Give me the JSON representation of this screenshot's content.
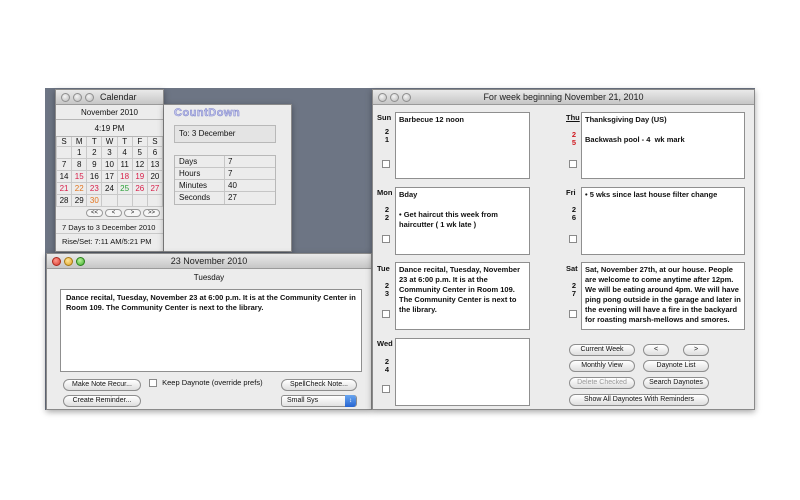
{
  "calendar": {
    "title": "Calendar",
    "month": "November 2010",
    "time": "4:19 PM",
    "weekdays": [
      "S",
      "M",
      "T",
      "W",
      "T",
      "F",
      "S"
    ],
    "weeks": [
      [
        "",
        "1",
        "2",
        "3",
        "4",
        "5",
        "6"
      ],
      [
        "7",
        "8",
        "9",
        "10",
        "11",
        "12",
        "13"
      ],
      [
        "14",
        "15",
        "16",
        "17",
        "18",
        "19",
        "20"
      ],
      [
        "21",
        "22",
        "23",
        "24",
        "25",
        "26",
        "27"
      ],
      [
        "28",
        "29",
        "30",
        "",
        "",
        "",
        ""
      ]
    ],
    "nav": [
      "<<",
      "<",
      ">",
      ">>"
    ],
    "days_to": "7 Days to 3 December 2010",
    "rise_set": "Rise/Set: 7:11 AM/5:21 PM"
  },
  "countdown": {
    "logo": "CountDown",
    "to": "To:  3 December",
    "rows": [
      {
        "k": "Days",
        "v": "7"
      },
      {
        "k": "Hours",
        "v": "7"
      },
      {
        "k": "Minutes",
        "v": "40"
      },
      {
        "k": "Seconds",
        "v": "27"
      }
    ]
  },
  "note": {
    "title": "23  November  2010",
    "day": "Tuesday",
    "text": "Dance recital, Tuesday, November 23 at 6:00 p.m.  It is at the  Community Center in Room 109.  The Community Center is next to the library.",
    "make_recurring": "Make Note Recur...",
    "keep_daynote": "Keep Daynote (override prefs)",
    "spellcheck": "SpellCheck Note...",
    "create_reminder": "Create Reminder...",
    "font_select": "Small Sys"
  },
  "week": {
    "title": "For week beginning November 21, 2010",
    "days": {
      "sun": {
        "label": "Sun",
        "n1": "2",
        "n2": "1",
        "text": "Barbecue 12 noon"
      },
      "mon": {
        "label": "Mon",
        "n1": "2",
        "n2": "2",
        "text": "Bday\n\n• Get haircut this week from  haircutter ( 1 wk late )"
      },
      "tue": {
        "label": "Tue",
        "n1": "2",
        "n2": "3",
        "text": "Dance recital, Tuesday, November 23 at 6:00 p.m.  It is at the  Community Center in Room 109.  The Community Center is next to the library."
      },
      "wed": {
        "label": "Wed",
        "n1": "2",
        "n2": "4",
        "text": ""
      },
      "thu": {
        "label": "Thu",
        "n1": "2",
        "n2": "5",
        "text": "Thanksgiving Day (US)\n\nBackwash pool - 4  wk mark"
      },
      "fri": {
        "label": "Fri",
        "n1": "2",
        "n2": "6",
        "text": "• 5 wks since last house filter change"
      },
      "sat": {
        "label": "Sat",
        "n1": "2",
        "n2": "7",
        "text": "Sat, November 27th, at our house.  People are welcome to come anytime after 12pm.  We will be eating around 4pm.  We will have ping pong outside in the garage and later in the evening will have a fire in the backyard for roasting marsh-mellows and smores."
      }
    },
    "buttons": {
      "current_week": "Current Week",
      "prev": "<",
      "next": ">",
      "monthly_view": "Monthly View",
      "daynote_list": "Daynote List",
      "delete_checked": "Delete Checked",
      "search_daynotes": "Search Daynotes",
      "show_all": "Show All Daynotes With Reminders"
    }
  },
  "colors": {
    "desktop": "#6d7584",
    "holiday_red": "#d0181f",
    "weekend_red": "#d8204a",
    "today_orange": "#e2751f",
    "green": "#2aa037"
  }
}
